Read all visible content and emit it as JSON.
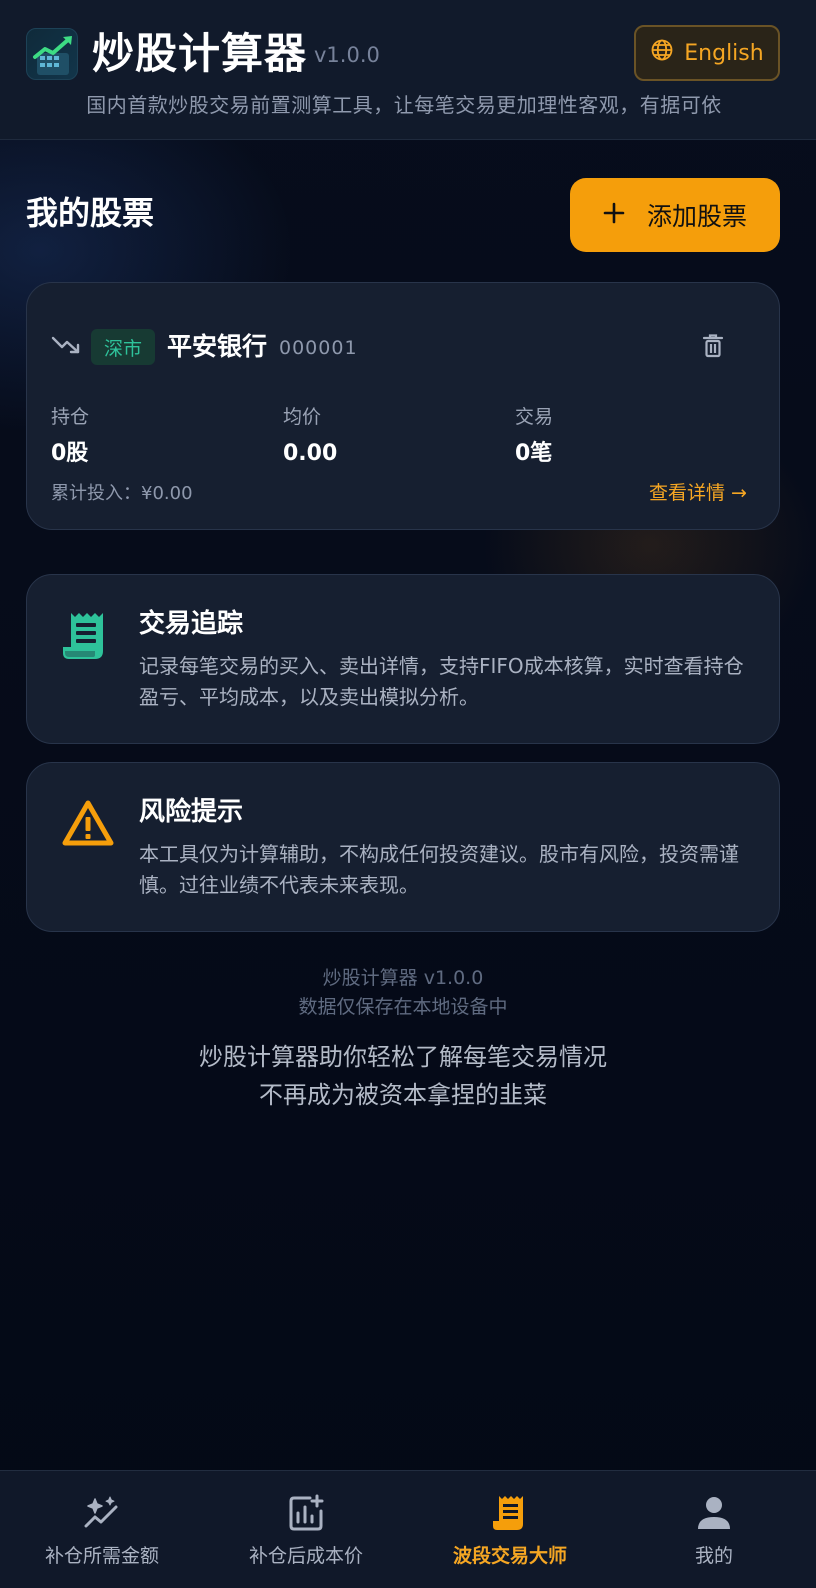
{
  "header": {
    "title": "炒股计算器",
    "version": "v1.0.0",
    "language_button": "English",
    "subtitle": "国内首款炒股交易前置测算工具，让每笔交易更加理性客观，有据可依"
  },
  "stocks_section": {
    "title": "我的股票",
    "add_button": "添加股票"
  },
  "stock_card": {
    "market": "深市",
    "name": "平安银行",
    "code": "000001",
    "stats": [
      {
        "label": "持仓",
        "value": "0股"
      },
      {
        "label": "均价",
        "value": "0.00"
      },
      {
        "label": "交易",
        "value": "0笔"
      }
    ],
    "total_invest": "累计投入：¥0.00",
    "detail_link": "查看详情",
    "detail_arrow": "→"
  },
  "info_cards": [
    {
      "icon": "receipt-icon",
      "title": "交易追踪",
      "text": "记录每笔交易的买入、卖出详情，支持FIFO成本核算，实时查看持仓盈亏、平均成本，以及卖出模拟分析。"
    },
    {
      "icon": "warning-icon",
      "title": "风险提示",
      "text": "本工具仅为计算辅助，不构成任何投资建议。股市有风险，投资需谨慎。过往业绩不代表未来表现。"
    }
  ],
  "footer": {
    "version_line": "炒股计算器 v1.0.0",
    "storage_line": "数据仅保存在本地设备中",
    "slogan_line1": "炒股计算器助你轻松了解每笔交易情况",
    "slogan_line2": "不再成为被资本拿捏的韭菜"
  },
  "bottom_nav": {
    "items": [
      {
        "label": "补仓所需金额",
        "icon": "sparkle-chart-icon",
        "active": false
      },
      {
        "label": "补仓后成本价",
        "icon": "chart-plus-icon",
        "active": false
      },
      {
        "label": "波段交易大师",
        "icon": "receipt-icon",
        "active": true
      },
      {
        "label": "我的",
        "icon": "person-icon",
        "active": false
      }
    ]
  },
  "colors": {
    "accent": "#f59e0b",
    "accent_text": "#f5a623",
    "green": "#2ec29a",
    "background": "#050a18",
    "card": "#161f30"
  }
}
